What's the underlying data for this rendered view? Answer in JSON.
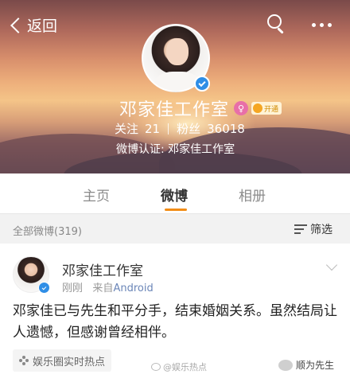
{
  "header": {
    "back_label": "返回",
    "profile_name": "邓家佳工作室",
    "female_symbol": "♀",
    "vip_label": "开通",
    "following_label": "关注",
    "following_count": "21",
    "followers_label": "粉丝",
    "followers_count": "36018",
    "verification": "微博认证: 邓家佳工作室",
    "icons": [
      "chevron-left-icon",
      "search-icon",
      "more-icon",
      "verified-icon",
      "female-icon",
      "vip-icon"
    ]
  },
  "tabs": [
    {
      "label": "主页",
      "active": false
    },
    {
      "label": "微博",
      "active": true
    },
    {
      "label": "相册",
      "active": false
    }
  ],
  "accent_color": "#f28c16",
  "filterbar": {
    "count_label": "全部微博(319)",
    "filter_label": "筛选"
  },
  "post": {
    "author": "邓家佳工作室",
    "time": "刚刚",
    "source_prefix": "来自",
    "source": "Android",
    "text": "邓家佳已与先生和平分手，结束婚姻关系。虽然结局让人遗憾，但感谢曾经相伴。",
    "tag": "娱乐圈实时热点"
  },
  "watermarks": {
    "left": "@娱乐热点",
    "right": "顺为先生"
  }
}
